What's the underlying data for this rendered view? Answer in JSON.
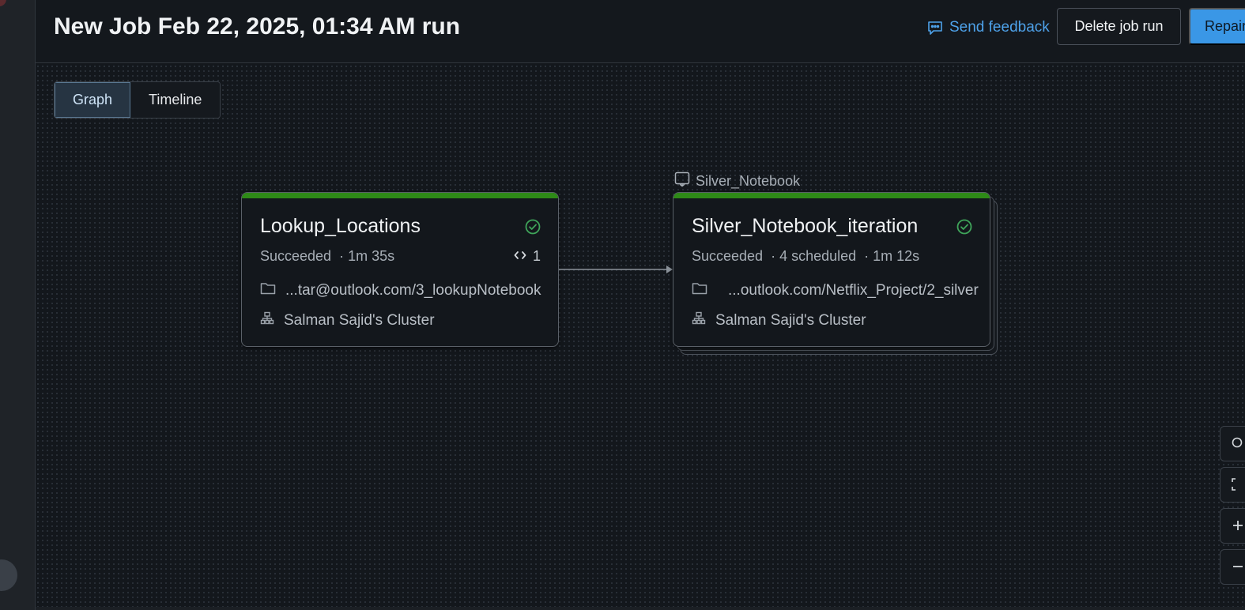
{
  "header": {
    "title": "New Job Feb 22, 2025, 01:34 AM run",
    "feedback_label": "Send feedback",
    "delete_label": "Delete job run",
    "repair_label": "Repair"
  },
  "view_toggle": {
    "graph_label": "Graph",
    "timeline_label": "Timeline",
    "active": "Graph"
  },
  "tasks": [
    {
      "title": "Lookup_Locations",
      "status": "Succeeded",
      "duration": "· 1m 35s",
      "iteration_count": "1",
      "path": "...tar@outlook.com/3_lookupNotebook",
      "cluster": "Salman Sajid's Cluster"
    },
    {
      "group_label": "Silver_Notebook",
      "title": "Silver_Notebook_iteration",
      "status": "Succeeded",
      "scheduled": "· 4 scheduled",
      "duration": "· 1m 12s",
      "path": "...outlook.com/Netflix_Project/2_silver",
      "cluster": "Salman Sajid's Cluster"
    }
  ],
  "colors": {
    "success": "#2e8a17",
    "accent": "#3a97e6",
    "link": "#4ea2ea"
  }
}
